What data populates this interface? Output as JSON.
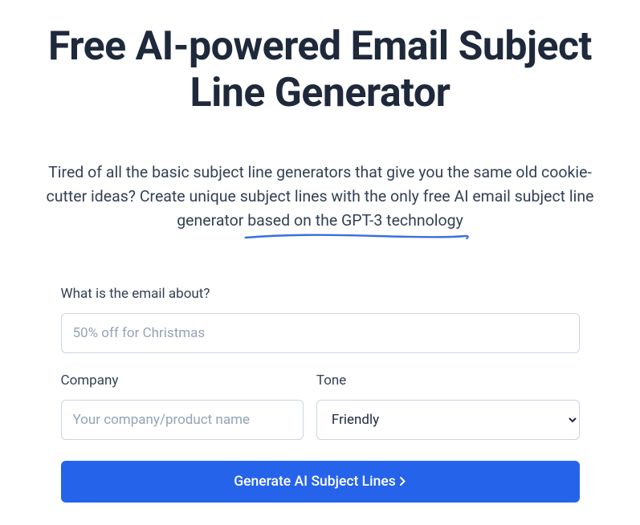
{
  "header": {
    "title": "Free AI-powered Email Subject Line Generator",
    "subtitle_pre": "Tired of all the basic subject line generators that give you the same old cookie-cutter ideas? Create unique subject lines with the only free AI email subject line generator ",
    "subtitle_underlined": "based on the GPT-3 technology"
  },
  "form": {
    "email_about": {
      "label": "What is the email about?",
      "placeholder": "50% off for Christmas",
      "value": ""
    },
    "company": {
      "label": "Company",
      "placeholder": "Your company/product name",
      "value": ""
    },
    "tone": {
      "label": "Tone",
      "selected": "Friendly"
    },
    "submit_label": "Generate AI Subject Lines"
  },
  "colors": {
    "accent": "#2563eb",
    "underline": "#3b6fe0"
  }
}
